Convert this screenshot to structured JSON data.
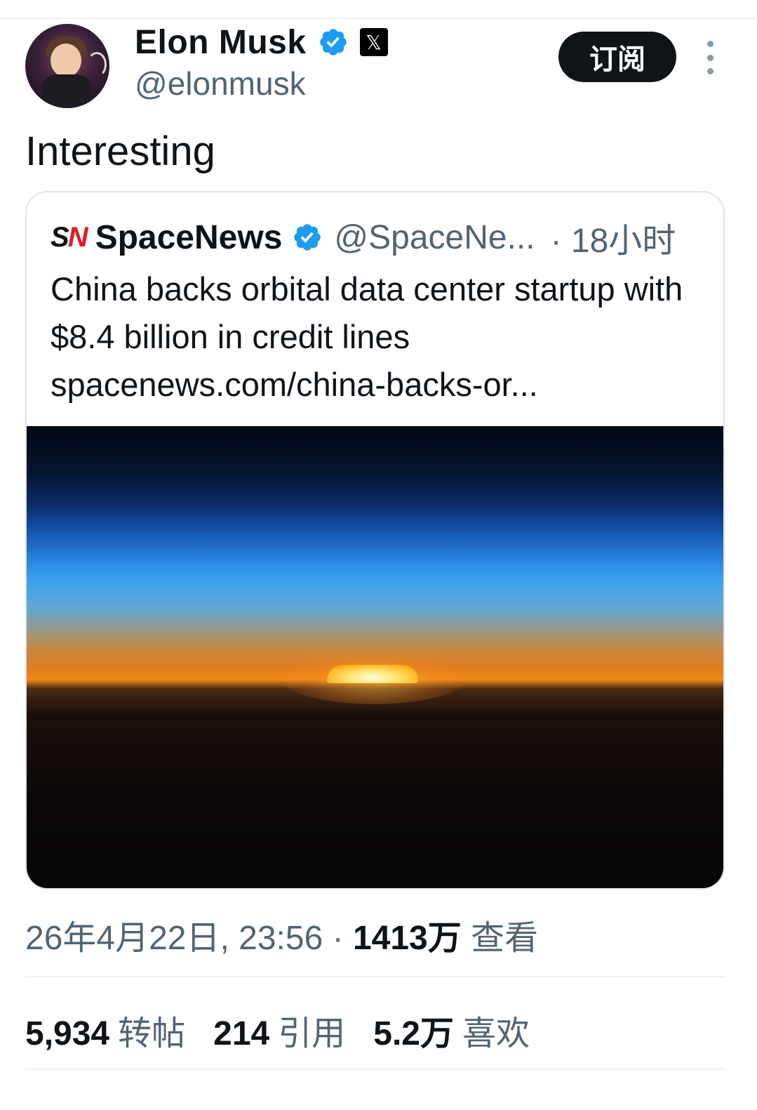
{
  "author": {
    "name": "Elon Musk",
    "handle": "@elonmusk",
    "avatar_icon": "avatar-image",
    "verified_icon": "verified-badge-icon",
    "affiliate_icon": "x-logo-icon",
    "verified_color": "#1d9bf0"
  },
  "actions": {
    "subscribe_label": "订阅",
    "more_icon": "more-vertical-icon"
  },
  "tweet": {
    "text": "Interesting"
  },
  "quote": {
    "logo_s": "S",
    "logo_n": "N",
    "name": "SpaceNews",
    "handle": "@SpaceNe...",
    "time": "· 18小时",
    "text": "China backs orbital data center startup with $8.4 billion in credit lines",
    "link": "spacenews.com/china-backs-or...",
    "image_alt": "sunrise-over-earth-from-orbit-image"
  },
  "meta": {
    "datetime": "26年4月22日, 23:56 · ",
    "views_count": "1413万",
    "views_label": " 查看"
  },
  "stats": [
    {
      "count": "5,934",
      "label": "转帖"
    },
    {
      "count": "214",
      "label": "引用"
    },
    {
      "count": "5.2万",
      "label": "喜欢"
    }
  ]
}
